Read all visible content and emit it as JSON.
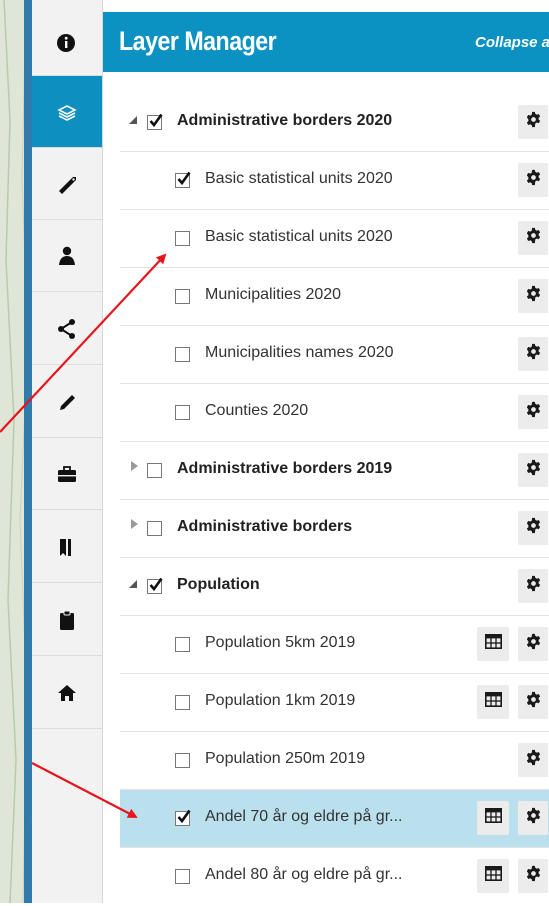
{
  "panel": {
    "title": "Layer Manager",
    "collapse_label": "Collapse all"
  },
  "toolbar": {
    "active_index": 1,
    "items": [
      {
        "icon": "info-icon"
      },
      {
        "icon": "layers-icon"
      },
      {
        "icon": "tag-icon"
      },
      {
        "icon": "user-icon"
      },
      {
        "icon": "share-icon"
      },
      {
        "icon": "pencil-icon"
      },
      {
        "icon": "briefcase-icon"
      },
      {
        "icon": "bookmark-icon"
      },
      {
        "icon": "clipboard-icon"
      },
      {
        "icon": "home-icon"
      }
    ]
  },
  "layers": [
    {
      "label": "Administrative borders 2020",
      "group": true,
      "expander": "open",
      "checked": true,
      "table": false,
      "highlight": false
    },
    {
      "label": "Basic statistical units 2020",
      "group": false,
      "expander": null,
      "checked": true,
      "table": false,
      "highlight": false
    },
    {
      "label": "Basic statistical units 2020",
      "group": false,
      "expander": null,
      "checked": false,
      "table": false,
      "highlight": false
    },
    {
      "label": "Municipalities 2020",
      "group": false,
      "expander": null,
      "checked": false,
      "table": false,
      "highlight": false
    },
    {
      "label": "Municipalities names 2020",
      "group": false,
      "expander": null,
      "checked": false,
      "table": false,
      "highlight": false
    },
    {
      "label": "Counties 2020",
      "group": false,
      "expander": null,
      "checked": false,
      "table": false,
      "highlight": false
    },
    {
      "label": "Administrative borders 2019",
      "group": true,
      "expander": "closed",
      "checked": false,
      "table": false,
      "highlight": false
    },
    {
      "label": "Administrative borders",
      "group": true,
      "expander": "closed",
      "checked": false,
      "table": false,
      "highlight": false
    },
    {
      "label": "Population",
      "group": true,
      "expander": "open",
      "checked": true,
      "table": false,
      "highlight": false
    },
    {
      "label": "Population 5km 2019",
      "group": false,
      "expander": null,
      "checked": false,
      "table": true,
      "highlight": false
    },
    {
      "label": "Population 1km 2019",
      "group": false,
      "expander": null,
      "checked": false,
      "table": true,
      "highlight": false
    },
    {
      "label": "Population 250m 2019",
      "group": false,
      "expander": null,
      "checked": false,
      "table": false,
      "highlight": false
    },
    {
      "label": "Andel 70 år og eldre på gr...",
      "group": false,
      "expander": null,
      "checked": true,
      "table": true,
      "highlight": true
    },
    {
      "label": "Andel 80 år og eldre på gr...",
      "group": false,
      "expander": null,
      "checked": false,
      "table": true,
      "highlight": false
    }
  ],
  "colors": {
    "header": "#0b92c2",
    "active_tool": "#0d90bf",
    "highlight_row": "#b9e0ec",
    "annotation_arrow": "#e8141c"
  }
}
